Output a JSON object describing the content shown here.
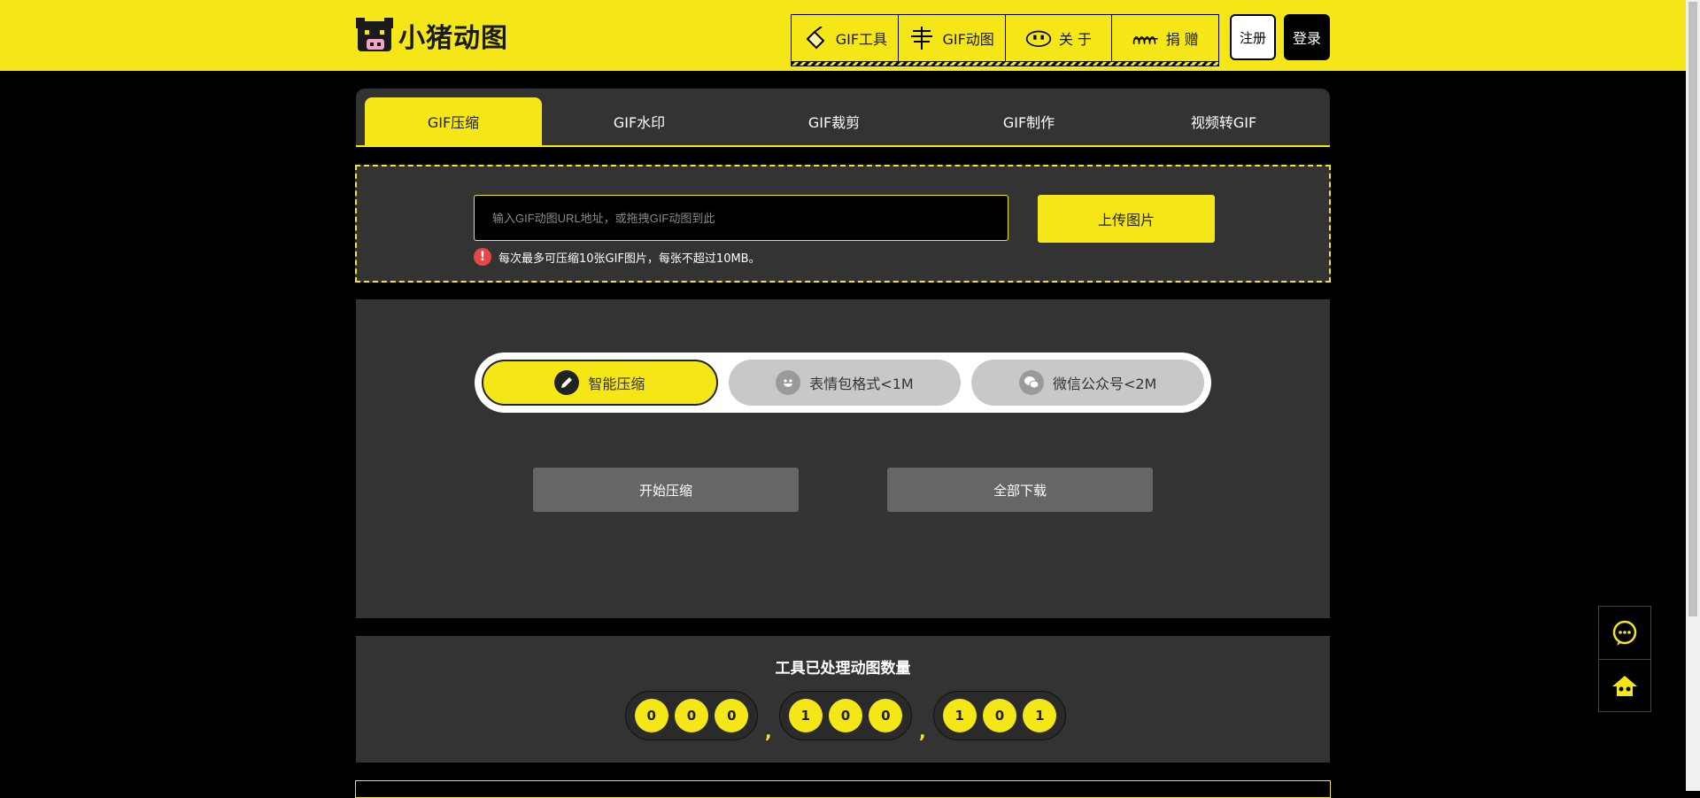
{
  "header": {
    "logo_text": "小猪动图",
    "nav": [
      {
        "label": "GIF工具",
        "icon": "shovel-icon"
      },
      {
        "label": "GIF动图",
        "icon": "signpost-icon"
      },
      {
        "label": "关 于",
        "icon": "pig-face-icon"
      },
      {
        "label": "捐 赠",
        "icon": "fence-icon"
      }
    ],
    "register_label": "注册",
    "login_label": "登录"
  },
  "tabs": [
    "GIF压缩",
    "GIF水印",
    "GIF裁剪",
    "GIF制作",
    "视频转GIF"
  ],
  "upload": {
    "placeholder": "输入GIF动图URL地址，或拖拽GIF动图到此",
    "button_label": "上传图片",
    "tip": "每次最多可压缩10张GIF图片，每张不超过10MB。"
  },
  "modes": [
    {
      "label": "智能压缩",
      "icon": "pencil-icon"
    },
    {
      "label": "表情包格式<1M",
      "icon": "smiley-icon"
    },
    {
      "label": "微信公众号<2M",
      "icon": "wechat-icon"
    }
  ],
  "actions": {
    "start_label": "开始压缩",
    "download_label": "全部下载"
  },
  "counter": {
    "title": "工具已处理动图数量",
    "groups": [
      [
        "0",
        "0",
        "0"
      ],
      [
        "1",
        "0",
        "0"
      ],
      [
        "1",
        "0",
        "1"
      ]
    ],
    "separator": ","
  },
  "colors": {
    "accent": "#f5e617",
    "panel": "#333333",
    "background": "#000000"
  }
}
